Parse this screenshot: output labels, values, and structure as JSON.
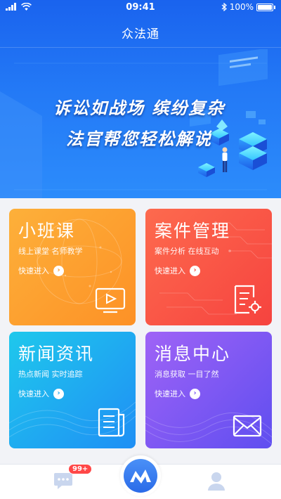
{
  "status_bar": {
    "time": "09:41",
    "battery": "100%"
  },
  "nav": {
    "title": "众法通"
  },
  "banner": {
    "line1": "诉讼如战场 缤纷复杂",
    "line2": "法官帮您轻松解说"
  },
  "cards": [
    {
      "title": "小班课",
      "subtitle": "线上课堂 名师教学",
      "enter": "快速进入",
      "icon": "video-icon",
      "color": "#fd9a2c"
    },
    {
      "title": "案件管理",
      "subtitle": "案件分析 在线互动",
      "enter": "快速进入",
      "icon": "document-gear-icon",
      "color": "#f55343"
    },
    {
      "title": "新闻资讯",
      "subtitle": "热点新闻 实时追踪",
      "enter": "快速进入",
      "icon": "newspaper-icon",
      "color": "#1fa8f0"
    },
    {
      "title": "消息中心",
      "subtitle": "消息获取 一目了然",
      "enter": "快速进入",
      "icon": "mail-icon",
      "color": "#7a58f3"
    }
  ],
  "tabbar": {
    "messages_badge": "99+"
  }
}
